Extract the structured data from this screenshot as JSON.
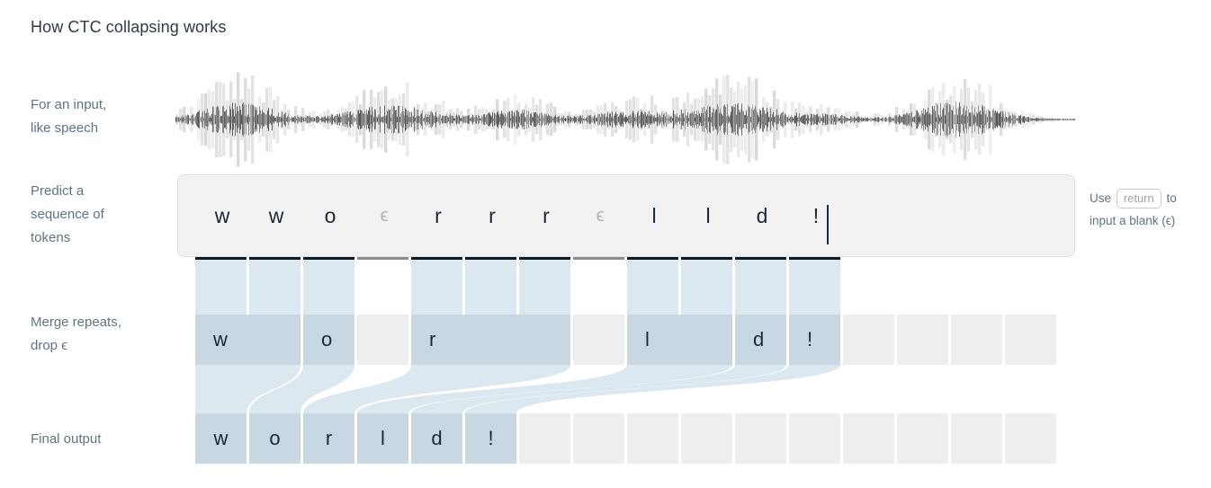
{
  "page": {
    "title": "How CTC collapsing works",
    "background": "#ffffff",
    "accent": "#c8d7e2",
    "ribbon_color": "#dce8f0",
    "empty_cell_color": "#eeeeee",
    "label_color": "#5f7482"
  },
  "labels": {
    "input": [
      "For an input,",
      "like speech"
    ],
    "predict": [
      "Predict a",
      "sequence of",
      "tokens"
    ],
    "merge": [
      "Merge repeats,",
      "drop ϵ"
    ],
    "final": [
      "Final output"
    ]
  },
  "hint": {
    "before": "Use",
    "key": "return",
    "middle": "to",
    "after": "input a blank (ϵ)"
  },
  "tokens": {
    "caret_after_index": 11,
    "items": [
      {
        "label": "w",
        "blank": false
      },
      {
        "label": "w",
        "blank": false
      },
      {
        "label": "o",
        "blank": false
      },
      {
        "label": "ϵ",
        "blank": true
      },
      {
        "label": "r",
        "blank": false
      },
      {
        "label": "r",
        "blank": false
      },
      {
        "label": "r",
        "blank": false
      },
      {
        "label": "ϵ",
        "blank": true
      },
      {
        "label": "l",
        "blank": false
      },
      {
        "label": "l",
        "blank": false
      },
      {
        "label": "d",
        "blank": false
      },
      {
        "label": "!",
        "blank": false
      }
    ]
  },
  "merge_row": {
    "total_cells": 16,
    "cells": [
      {
        "label": "w",
        "start": 0,
        "span": 2,
        "filled": true
      },
      {
        "label": "o",
        "start": 2,
        "span": 1,
        "filled": true
      },
      {
        "label": "",
        "start": 3,
        "span": 1,
        "filled": false
      },
      {
        "label": "r",
        "start": 4,
        "span": 3,
        "filled": true
      },
      {
        "label": "",
        "start": 7,
        "span": 1,
        "filled": false
      },
      {
        "label": "l",
        "start": 8,
        "span": 2,
        "filled": true
      },
      {
        "label": "d",
        "start": 10,
        "span": 1,
        "filled": true
      },
      {
        "label": "!",
        "start": 11,
        "span": 1,
        "filled": true
      },
      {
        "label": "",
        "start": 12,
        "span": 1,
        "filled": false
      },
      {
        "label": "",
        "start": 13,
        "span": 1,
        "filled": false
      },
      {
        "label": "",
        "start": 14,
        "span": 1,
        "filled": false
      },
      {
        "label": "",
        "start": 15,
        "span": 1,
        "filled": false
      }
    ]
  },
  "final_row": {
    "total_cells": 16,
    "text": "world!",
    "cells": [
      {
        "label": "w",
        "filled": true
      },
      {
        "label": "o",
        "filled": true
      },
      {
        "label": "r",
        "filled": true
      },
      {
        "label": "l",
        "filled": true
      },
      {
        "label": "d",
        "filled": true
      },
      {
        "label": "!",
        "filled": true
      },
      {
        "label": "",
        "filled": false
      },
      {
        "label": "",
        "filled": false
      },
      {
        "label": "",
        "filled": false
      },
      {
        "label": "",
        "filled": false
      },
      {
        "label": "",
        "filled": false
      },
      {
        "label": "",
        "filled": false
      },
      {
        "label": "",
        "filled": false
      },
      {
        "label": "",
        "filled": false
      },
      {
        "label": "",
        "filled": false
      },
      {
        "label": "",
        "filled": false
      }
    ]
  },
  "waveform": {
    "description": "speech-waveform",
    "color": "#4a4a4a"
  }
}
